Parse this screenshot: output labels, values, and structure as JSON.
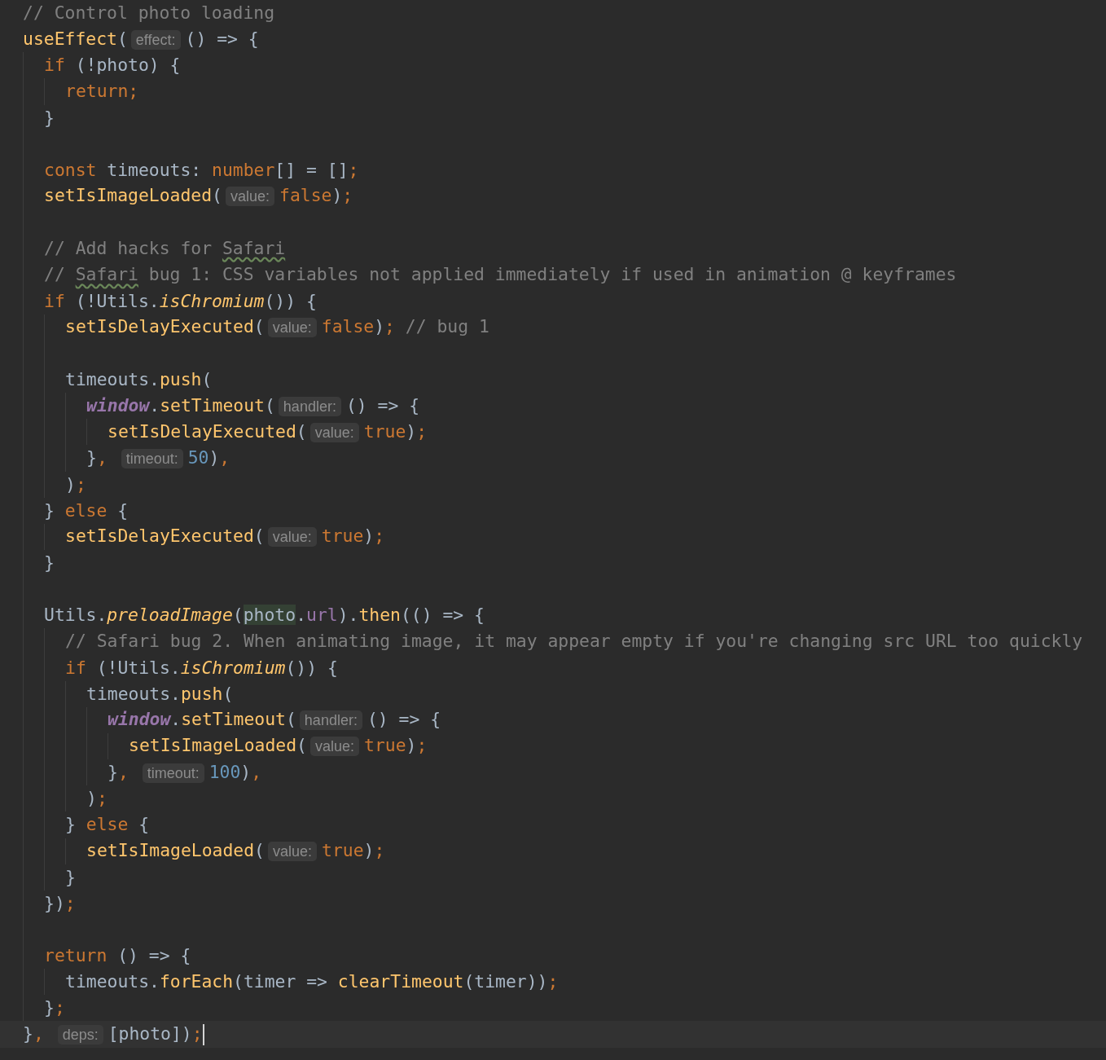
{
  "editor": {
    "lines": [
      {
        "kind": "code",
        "current": false,
        "tokens": [
          {
            "kind": "comment",
            "text": "// Control photo loading"
          }
        ]
      },
      {
        "kind": "code",
        "current": false,
        "tokens": [
          {
            "kind": "fn",
            "text": "useEffect"
          },
          {
            "kind": "plain",
            "text": "("
          },
          {
            "kind": "hint",
            "text": "effect:"
          },
          {
            "kind": "plain",
            "text": "() => {"
          }
        ],
        "children": [
          {
            "kind": "code",
            "current": false,
            "tokens": [
              {
                "kind": "keyword",
                "text": "if"
              },
              {
                "kind": "plain",
                "text": " (!photo) {"
              }
            ],
            "children": [
              {
                "kind": "code",
                "current": false,
                "tokens": [
                  {
                    "kind": "keyword",
                    "text": "return;"
                  }
                ]
              }
            ]
          },
          {
            "kind": "code",
            "current": false,
            "tokens": [
              {
                "kind": "plain",
                "text": "}"
              }
            ]
          },
          {
            "kind": "blank",
            "current": false
          },
          {
            "kind": "code",
            "current": false,
            "tokens": [
              {
                "kind": "keyword",
                "text": "const"
              },
              {
                "kind": "plain",
                "text": " timeouts: "
              },
              {
                "kind": "keyword",
                "text": "number"
              },
              {
                "kind": "plain",
                "text": "[] = []"
              },
              {
                "kind": "keyword",
                "text": ";"
              }
            ]
          },
          {
            "kind": "code",
            "current": false,
            "tokens": [
              {
                "kind": "fn",
                "text": "setIsImageLoaded"
              },
              {
                "kind": "plain",
                "text": "("
              },
              {
                "kind": "hint",
                "text": "value:"
              },
              {
                "kind": "keyword",
                "text": "false"
              },
              {
                "kind": "plain",
                "text": ")"
              },
              {
                "kind": "keyword",
                "text": ";"
              }
            ]
          },
          {
            "kind": "blank",
            "current": false
          },
          {
            "kind": "code",
            "current": false,
            "tokens": [
              {
                "kind": "comment",
                "text": "// Add hacks for "
              },
              {
                "kind": "typo",
                "text": "Safari"
              }
            ]
          },
          {
            "kind": "code",
            "current": false,
            "tokens": [
              {
                "kind": "comment",
                "text": "// "
              },
              {
                "kind": "typo",
                "text": "Safari"
              },
              {
                "kind": "comment",
                "text": " bug 1: CSS variables not applied immediately if used in animation @ keyframes"
              }
            ]
          },
          {
            "kind": "code",
            "current": false,
            "tokens": [
              {
                "kind": "keyword",
                "text": "if"
              },
              {
                "kind": "plain",
                "text": " (!Utils."
              },
              {
                "kind": "fn-italic",
                "text": "isChromium"
              },
              {
                "kind": "plain",
                "text": "()) {"
              }
            ],
            "children": [
              {
                "kind": "code",
                "current": false,
                "tokens": [
                  {
                    "kind": "fn",
                    "text": "setIsDelayExecuted"
                  },
                  {
                    "kind": "plain",
                    "text": "("
                  },
                  {
                    "kind": "hint",
                    "text": "value:"
                  },
                  {
                    "kind": "keyword",
                    "text": "false"
                  },
                  {
                    "kind": "plain",
                    "text": ")"
                  },
                  {
                    "kind": "keyword",
                    "text": ";"
                  },
                  {
                    "kind": "comment",
                    "text": " // bug 1"
                  }
                ]
              },
              {
                "kind": "blank",
                "current": false
              },
              {
                "kind": "code",
                "current": false,
                "tokens": [
                  {
                    "kind": "plain",
                    "text": "timeouts."
                  },
                  {
                    "kind": "fn",
                    "text": "push"
                  },
                  {
                    "kind": "plain",
                    "text": "("
                  }
                ],
                "children": [
                  {
                    "kind": "code",
                    "current": false,
                    "tokens": [
                      {
                        "kind": "global",
                        "text": "window"
                      },
                      {
                        "kind": "plain",
                        "text": "."
                      },
                      {
                        "kind": "fn",
                        "text": "setTimeout"
                      },
                      {
                        "kind": "plain",
                        "text": "("
                      },
                      {
                        "kind": "hint",
                        "text": "handler:"
                      },
                      {
                        "kind": "plain",
                        "text": "() => {"
                      }
                    ],
                    "children": [
                      {
                        "kind": "code",
                        "current": false,
                        "tokens": [
                          {
                            "kind": "fn",
                            "text": "setIsDelayExecuted"
                          },
                          {
                            "kind": "plain",
                            "text": "("
                          },
                          {
                            "kind": "hint",
                            "text": "value:"
                          },
                          {
                            "kind": "keyword",
                            "text": "true"
                          },
                          {
                            "kind": "plain",
                            "text": ")"
                          },
                          {
                            "kind": "keyword",
                            "text": ";"
                          }
                        ]
                      }
                    ]
                  },
                  {
                    "kind": "code",
                    "current": false,
                    "tokens": [
                      {
                        "kind": "plain",
                        "text": "}"
                      },
                      {
                        "kind": "keyword",
                        "text": ", "
                      },
                      {
                        "kind": "hint",
                        "text": "timeout:"
                      },
                      {
                        "kind": "number",
                        "text": "50"
                      },
                      {
                        "kind": "plain",
                        "text": ")"
                      },
                      {
                        "kind": "keyword",
                        "text": ","
                      }
                    ]
                  }
                ]
              },
              {
                "kind": "code",
                "current": false,
                "tokens": [
                  {
                    "kind": "plain",
                    "text": ")"
                  },
                  {
                    "kind": "keyword",
                    "text": ";"
                  }
                ]
              }
            ]
          },
          {
            "kind": "code",
            "current": false,
            "tokens": [
              {
                "kind": "plain",
                "text": "} "
              },
              {
                "kind": "keyword",
                "text": "else"
              },
              {
                "kind": "plain",
                "text": " {"
              }
            ],
            "children": [
              {
                "kind": "code",
                "current": false,
                "tokens": [
                  {
                    "kind": "fn",
                    "text": "setIsDelayExecuted"
                  },
                  {
                    "kind": "plain",
                    "text": "("
                  },
                  {
                    "kind": "hint",
                    "text": "value:"
                  },
                  {
                    "kind": "keyword",
                    "text": "true"
                  },
                  {
                    "kind": "plain",
                    "text": ")"
                  },
                  {
                    "kind": "keyword",
                    "text": ";"
                  }
                ]
              }
            ]
          },
          {
            "kind": "code",
            "current": false,
            "tokens": [
              {
                "kind": "plain",
                "text": "}"
              }
            ]
          },
          {
            "kind": "blank",
            "current": false
          },
          {
            "kind": "code",
            "current": false,
            "tokens": [
              {
                "kind": "plain",
                "text": "Utils."
              },
              {
                "kind": "fn-italic",
                "text": "preloadImage"
              },
              {
                "kind": "plain",
                "text": "("
              },
              {
                "kind": "ref",
                "text": "photo"
              },
              {
                "kind": "plain",
                "text": "."
              },
              {
                "kind": "field",
                "text": "url"
              },
              {
                "kind": "plain",
                "text": ")."
              },
              {
                "kind": "fn",
                "text": "then"
              },
              {
                "kind": "plain",
                "text": "(() => {"
              }
            ],
            "children": [
              {
                "kind": "code",
                "current": false,
                "tokens": [
                  {
                    "kind": "comment",
                    "text": "// Safari bug 2. When animating image, it may appear empty if you're changing src URL too quickly"
                  }
                ]
              },
              {
                "kind": "code",
                "current": false,
                "tokens": [
                  {
                    "kind": "keyword",
                    "text": "if"
                  },
                  {
                    "kind": "plain",
                    "text": " (!Utils."
                  },
                  {
                    "kind": "fn-italic",
                    "text": "isChromium"
                  },
                  {
                    "kind": "plain",
                    "text": "()) {"
                  }
                ],
                "children": [
                  {
                    "kind": "code",
                    "current": false,
                    "tokens": [
                      {
                        "kind": "plain",
                        "text": "timeouts."
                      },
                      {
                        "kind": "fn",
                        "text": "push"
                      },
                      {
                        "kind": "plain",
                        "text": "("
                      }
                    ],
                    "children": [
                      {
                        "kind": "code",
                        "current": false,
                        "tokens": [
                          {
                            "kind": "global",
                            "text": "window"
                          },
                          {
                            "kind": "plain",
                            "text": "."
                          },
                          {
                            "kind": "fn",
                            "text": "setTimeout"
                          },
                          {
                            "kind": "plain",
                            "text": "("
                          },
                          {
                            "kind": "hint",
                            "text": "handler:"
                          },
                          {
                            "kind": "plain",
                            "text": "() => {"
                          }
                        ],
                        "children": [
                          {
                            "kind": "code",
                            "current": false,
                            "tokens": [
                              {
                                "kind": "fn",
                                "text": "setIsImageLoaded"
                              },
                              {
                                "kind": "plain",
                                "text": "("
                              },
                              {
                                "kind": "hint",
                                "text": "value:"
                              },
                              {
                                "kind": "keyword",
                                "text": "true"
                              },
                              {
                                "kind": "plain",
                                "text": ")"
                              },
                              {
                                "kind": "keyword",
                                "text": ";"
                              }
                            ]
                          }
                        ]
                      },
                      {
                        "kind": "code",
                        "current": false,
                        "tokens": [
                          {
                            "kind": "plain",
                            "text": "}"
                          },
                          {
                            "kind": "keyword",
                            "text": ", "
                          },
                          {
                            "kind": "hint",
                            "text": "timeout:"
                          },
                          {
                            "kind": "number",
                            "text": "100"
                          },
                          {
                            "kind": "plain",
                            "text": ")"
                          },
                          {
                            "kind": "keyword",
                            "text": ","
                          }
                        ]
                      }
                    ]
                  },
                  {
                    "kind": "code",
                    "current": false,
                    "tokens": [
                      {
                        "kind": "plain",
                        "text": ")"
                      },
                      {
                        "kind": "keyword",
                        "text": ";"
                      }
                    ]
                  }
                ]
              },
              {
                "kind": "code",
                "current": false,
                "tokens": [
                  {
                    "kind": "plain",
                    "text": "} "
                  },
                  {
                    "kind": "keyword",
                    "text": "else"
                  },
                  {
                    "kind": "plain",
                    "text": " {"
                  }
                ],
                "children": [
                  {
                    "kind": "code",
                    "current": false,
                    "tokens": [
                      {
                        "kind": "fn",
                        "text": "setIsImageLoaded"
                      },
                      {
                        "kind": "plain",
                        "text": "("
                      },
                      {
                        "kind": "hint",
                        "text": "value:"
                      },
                      {
                        "kind": "keyword",
                        "text": "true"
                      },
                      {
                        "kind": "plain",
                        "text": ")"
                      },
                      {
                        "kind": "keyword",
                        "text": ";"
                      }
                    ]
                  }
                ]
              },
              {
                "kind": "code",
                "current": false,
                "tokens": [
                  {
                    "kind": "plain",
                    "text": "}"
                  }
                ]
              }
            ]
          },
          {
            "kind": "code",
            "current": false,
            "tokens": [
              {
                "kind": "plain",
                "text": "})"
              },
              {
                "kind": "keyword",
                "text": ";"
              }
            ]
          },
          {
            "kind": "blank",
            "current": false
          },
          {
            "kind": "code",
            "current": false,
            "tokens": [
              {
                "kind": "keyword",
                "text": "return"
              },
              {
                "kind": "plain",
                "text": " () => {"
              }
            ],
            "children": [
              {
                "kind": "code",
                "current": false,
                "tokens": [
                  {
                    "kind": "plain",
                    "text": "timeouts."
                  },
                  {
                    "kind": "fn",
                    "text": "forEach"
                  },
                  {
                    "kind": "plain",
                    "text": "(timer => "
                  },
                  {
                    "kind": "fn",
                    "text": "clearTimeout"
                  },
                  {
                    "kind": "plain",
                    "text": "(timer))"
                  },
                  {
                    "kind": "keyword",
                    "text": ";"
                  }
                ]
              }
            ]
          },
          {
            "kind": "code",
            "current": false,
            "tokens": [
              {
                "kind": "plain",
                "text": "}"
              },
              {
                "kind": "keyword",
                "text": ";"
              }
            ]
          }
        ]
      },
      {
        "kind": "code",
        "current": true,
        "tokens": [
          {
            "kind": "plain",
            "text": "}"
          },
          {
            "kind": "keyword",
            "text": ", "
          },
          {
            "kind": "hint",
            "text": "deps:"
          },
          {
            "kind": "plain",
            "text": "[photo])"
          },
          {
            "kind": "keyword",
            "text": ";"
          }
        ]
      }
    ]
  }
}
